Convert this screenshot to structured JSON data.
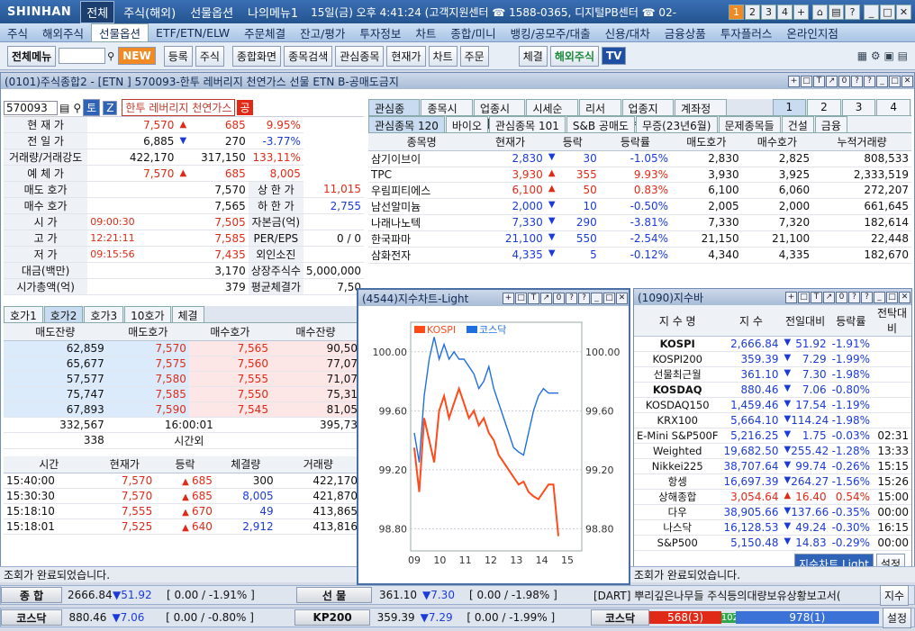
{
  "titlebar": {
    "logo": "SHINHAN",
    "tabs": [
      "전체",
      "주식(해외)",
      "선물옵션",
      "나의메뉴1"
    ],
    "info": "15일(금) 오후 4:41:24 (고객지원센터 ☎ 1588-0365, 디지털PB센터 ☎ 02-",
    "wbtns": [
      "1",
      "2",
      "3",
      "4",
      "+",
      "⌂",
      "▤",
      "?",
      "_",
      "□",
      "✕"
    ]
  },
  "menubar": [
    "주식",
    "해외주식",
    "선물옵션",
    "ETF/ETN/ELW",
    "주문체결",
    "잔고/평가",
    "투자정보",
    "차트",
    "종합/미니",
    "뱅킹/공모주/대출",
    "신용/대차",
    "금융상품",
    "투자플러스",
    "온라인지점"
  ],
  "toolbar": {
    "all_menu": "전체메뉴",
    "new": "NEW",
    "buttons": [
      "등록",
      "주식",
      "종합화면",
      "종목검색",
      "관심종목",
      "현재가",
      "차트",
      "주문"
    ],
    "exec": "체결",
    "overseas": "해외주식",
    "tv": "TV"
  },
  "main_window": {
    "title": "(0101)주식종합2 - [ETN ] 570093-한투 레버리지 천연가스 선물 ETN B-공매도금지",
    "code": "570093",
    "name": "한투 레버리지 천연가스",
    "badge": "공",
    "tbtns": [
      "토",
      "Z"
    ]
  },
  "quote": [
    {
      "l": "현 재 가",
      "v1": "7,570",
      "ar": "▲",
      "v2": "685",
      "v3": "9.95%",
      "c": "up"
    },
    {
      "l": "전 일 가",
      "v1": "6,885",
      "ar": "▼",
      "v2": "270",
      "v3": "-3.77%",
      "c": "dn2"
    },
    {
      "l": "거래량/거래강도",
      "v1": "422,170",
      "ar": "",
      "v2": "317,150",
      "v3": "133,11%",
      "c": "up3"
    },
    {
      "l": "예 체 가",
      "v1": "7,570",
      "ar": "▲",
      "v2": "685",
      "v3": "8,005",
      "c": "up"
    }
  ],
  "quote2": [
    {
      "l": "매도 호가",
      "v": "7,570",
      "l2": "상 한 가",
      "v2": "11,015",
      "c2": "up"
    },
    {
      "l": "매수 호가",
      "v": "7,565",
      "l2": "하 한 가",
      "v2": "2,755",
      "c2": "dn"
    },
    {
      "l": "시 가",
      "t": "09:00:30",
      "v": "7,505",
      "l2": "자본금(억)",
      "v2": ""
    },
    {
      "l": "고 가",
      "t": "12:21:11",
      "v": "7,585",
      "l2": "PER/EPS",
      "v2": "0 / 0"
    },
    {
      "l": "저 가",
      "t": "09:15:56",
      "v": "7,435",
      "l2": "외인소진",
      "v2": ""
    },
    {
      "l": "대금(백만)",
      "v": "3,170",
      "l2": "상장주식수",
      "v2": "5,000,000"
    },
    {
      "l": "시가총액(억)",
      "v": "379",
      "l2": "평균체결가",
      "v2": "7,50"
    }
  ],
  "hoga_tabs": [
    "호가1",
    "호가2",
    "호가3",
    "10호가",
    "체결"
  ],
  "hoga_head": [
    "매도잔량",
    "매도호가",
    "매수호가",
    "매수잔량"
  ],
  "hoga_rows": [
    [
      "62,859",
      "7,570",
      "7,565",
      "90,50"
    ],
    [
      "65,677",
      "7,575",
      "7,560",
      "77,07"
    ],
    [
      "57,577",
      "7,580",
      "7,555",
      "71,07"
    ],
    [
      "75,747",
      "7,585",
      "7,550",
      "75,31"
    ],
    [
      "67,893",
      "7,590",
      "7,545",
      "81,05"
    ]
  ],
  "hoga_sum": {
    "ask": "332,567",
    "time": "16:00:01",
    "bid": "395,73"
  },
  "hoga_after": {
    "v": "338",
    "l": "시간외"
  },
  "trade_head": [
    "시간",
    "현재가",
    "등락",
    "체결량",
    "거래량"
  ],
  "trades": [
    [
      "15:40:00",
      "7,570",
      "685",
      "300",
      "422,170"
    ],
    [
      "15:30:30",
      "7,570",
      "685",
      "8,005",
      "421,870"
    ],
    [
      "15:18:10",
      "7,555",
      "670",
      "49",
      "413,865"
    ],
    [
      "15:18:01",
      "7,525",
      "640",
      "2,912",
      "413,816"
    ]
  ],
  "watch_tabs": [
    "관심종목",
    "종목시세",
    "업종시세",
    "시세순위",
    "리서치",
    "업종지수",
    "계좌정보"
  ],
  "watch_pages": [
    "1",
    "2",
    "3",
    "4"
  ],
  "watch_subtabs": [
    "관심종목 120",
    "바이오",
    "관심종목 101",
    "S&B 공매도",
    "무증(23년6월)",
    "문제종목들",
    "건설",
    "금융"
  ],
  "watch_head": [
    "종목명",
    "현재가",
    "등락",
    "등락률",
    "매도호가",
    "매수호가",
    "누적거래량"
  ],
  "watch_rows": [
    {
      "n": "삼기이브이",
      "p": "2,830",
      "a": "▼",
      "d": "30",
      "r": "-1.05%",
      "s": "2,830",
      "b": "2,825",
      "v": "808,533",
      "c": "dn"
    },
    {
      "n": "TPC",
      "p": "3,930",
      "a": "▲",
      "d": "355",
      "r": "9.93%",
      "s": "3,930",
      "b": "3,925",
      "v": "2,333,519",
      "c": "up"
    },
    {
      "n": "우림피티에스",
      "p": "6,100",
      "a": "▲",
      "d": "50",
      "r": "0.83%",
      "s": "6,100",
      "b": "6,060",
      "v": "272,207",
      "c": "up"
    },
    {
      "n": "남선알미늄",
      "p": "2,000",
      "a": "▼",
      "d": "10",
      "r": "-0.50%",
      "s": "2,005",
      "b": "2,000",
      "v": "661,645",
      "c": "dn"
    },
    {
      "n": "나래나노텍",
      "p": "7,330",
      "a": "▼",
      "d": "290",
      "r": "-3.81%",
      "s": "7,330",
      "b": "7,320",
      "v": "182,614",
      "c": "dn"
    },
    {
      "n": "한국파마",
      "p": "21,100",
      "a": "▼",
      "d": "550",
      "r": "-2.54%",
      "s": "21,150",
      "b": "21,100",
      "v": "22,448",
      "c": "dn"
    },
    {
      "n": "삼화전자",
      "p": "4,335",
      "a": "▼",
      "d": "5",
      "r": "-0.12%",
      "s": "4,340",
      "b": "4,335",
      "v": "182,670",
      "c": "dn"
    }
  ],
  "chart_window": {
    "title": "(4544)지수차트-Light"
  },
  "chart_data": {
    "type": "line",
    "x_ticks": [
      "09",
      "10",
      "11",
      "12",
      "13",
      "14",
      "15"
    ],
    "y_ticks": [
      "100.00",
      "99.60",
      "99.20",
      "98.80"
    ],
    "ylim": [
      98.65,
      100.2
    ],
    "series": [
      {
        "name": "KOSPI",
        "color": "#ff4a1a",
        "values": [
          99.35,
          99.05,
          99.55,
          99.4,
          99.25,
          99.6,
          99.7,
          99.55,
          99.65,
          99.75,
          99.65,
          99.55,
          99.6,
          99.5,
          99.55,
          99.45,
          99.4,
          99.3,
          99.25,
          99.2,
          99.15,
          99.1,
          99.12,
          99.05,
          99.02,
          99.0,
          99.05,
          99.1,
          99.1,
          98.75
        ]
      },
      {
        "name": "코스닥",
        "color": "#1f6fe0",
        "values": [
          99.45,
          99.25,
          99.7,
          99.95,
          100.1,
          99.95,
          100.05,
          99.95,
          100.0,
          99.95,
          99.95,
          99.9,
          99.85,
          99.75,
          99.8,
          99.9,
          99.75,
          99.65,
          99.55,
          99.45,
          99.35,
          99.32,
          99.3,
          99.45,
          99.6,
          99.7,
          99.75,
          99.72,
          99.72,
          99.72
        ]
      }
    ]
  },
  "index_window": {
    "title": "(1090)지수바"
  },
  "index_head": [
    "지 수 명",
    "지 수",
    "전일대비",
    "등락률",
    "전탁대비"
  ],
  "index_rows": [
    {
      "n": "KOSPI",
      "v": "2,666.84",
      "d": "51.92",
      "r": "-1.91%",
      "t": "",
      "bold": true
    },
    {
      "n": "KOSPI200",
      "v": "359.39",
      "d": "7.29",
      "r": "-1.99%",
      "t": ""
    },
    {
      "n": "선물최근월",
      "v": "361.10",
      "d": "7.30",
      "r": "-1.98%",
      "t": ""
    },
    {
      "n": "KOSDAQ",
      "v": "880.46",
      "d": "7.06",
      "r": "-0.80%",
      "t": "",
      "bold": true
    },
    {
      "n": "KOSDAQ150",
      "v": "1,459.46",
      "d": "17.54",
      "r": "-1.19%",
      "t": ""
    },
    {
      "n": "KRX100",
      "v": "5,664.10",
      "d": "114.24",
      "r": "-1.98%",
      "t": ""
    },
    {
      "n": "E-Mini S&P500F",
      "v": "5,216.25",
      "d": "1.75",
      "r": "-0.03%",
      "t": "02:31"
    },
    {
      "n": "Weighted",
      "v": "19,682.50",
      "d": "255.42",
      "r": "-1.28%",
      "t": "13:33"
    },
    {
      "n": "Nikkei225",
      "v": "38,707.64",
      "d": "99.74",
      "r": "-0.26%",
      "t": "15:15"
    },
    {
      "n": "항셍",
      "v": "16,697.39",
      "d": "264.27",
      "r": "-1.56%",
      "t": "15:26"
    },
    {
      "n": "상해종합",
      "v": "3,054.64",
      "d": "16.40",
      "r": "0.54%",
      "t": "15:00",
      "up": true
    },
    {
      "n": "다우",
      "v": "38,905.66",
      "d": "137.66",
      "r": "-0.35%",
      "t": "00:00"
    },
    {
      "n": "나스닥",
      "v": "16,128.53",
      "d": "49.24",
      "r": "-0.30%",
      "t": "16:15"
    },
    {
      "n": "S&P500",
      "v": "5,150.48",
      "d": "14.83",
      "r": "-0.29%",
      "t": "00:00"
    }
  ],
  "index_buttons": [
    "지수차트 Light",
    "설정"
  ],
  "status": {
    "left": "조회가 완료되었습니다.",
    "right": "조회가 완료되었습니다."
  },
  "ticker1": [
    {
      "n": "종 합",
      "v": "2666.84",
      "d": "▼51.92",
      "r": "[ 0.00  / -1.91% ]"
    },
    {
      "n": "선 물",
      "v": "361.10",
      "d": "▼7.30",
      "r": "[ 0.00  / -1.98% ]"
    }
  ],
  "ticker2": [
    {
      "n": "코스닥",
      "v": "880.46",
      "d": "▼7.06",
      "r": "[ 0.00  / -0.80% ]"
    },
    {
      "n": "KP200",
      "v": "359.39",
      "d": "▼7.29",
      "r": "[ 0.00  / -1.99% ]"
    }
  ],
  "news": "[DART] 뿌리깊은나무들 주식등의대량보유상황보고서(",
  "news_btn": "지수",
  "breadth": {
    "n": "코스닥",
    "down": "568(3)",
    "flat": "102",
    "up": "978(1)",
    "btn": "설정"
  }
}
